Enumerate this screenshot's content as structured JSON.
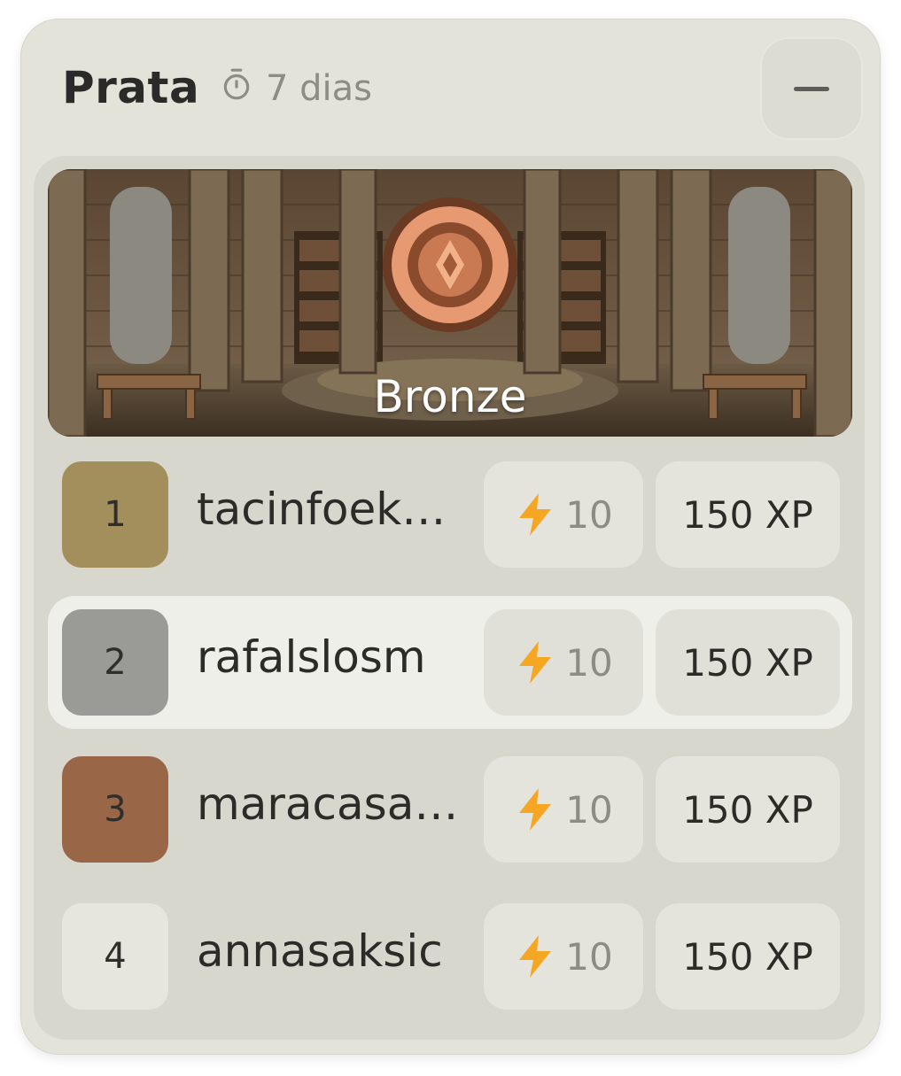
{
  "header": {
    "title": "Prata",
    "timer_text": "7 dias",
    "timer_icon": "stopwatch-icon",
    "minimize_icon": "minus-icon"
  },
  "banner": {
    "label": "Bronze",
    "badge_icon": "bronze-medal-icon"
  },
  "leaderboard": [
    {
      "rank": "1",
      "username": "tacinfoekpqa",
      "streak": "10",
      "xp": "150 XP",
      "rank_color": "#a38f5c",
      "highlighted": false
    },
    {
      "rank": "2",
      "username": "rafalslosm",
      "streak": "10",
      "xp": "150 XP",
      "rank_color": "#9a9a96",
      "highlighted": true
    },
    {
      "rank": "3",
      "username": "maracasarte",
      "streak": "10",
      "xp": "150 XP",
      "rank_color": "#9a6648",
      "highlighted": false
    },
    {
      "rank": "4",
      "username": "annasaksic",
      "streak": "10",
      "xp": "150 XP",
      "rank_color": "#e6e6de",
      "highlighted": false
    }
  ],
  "colors": {
    "streak_icon": "#f5a623",
    "card_bg": "#e3e3da"
  }
}
